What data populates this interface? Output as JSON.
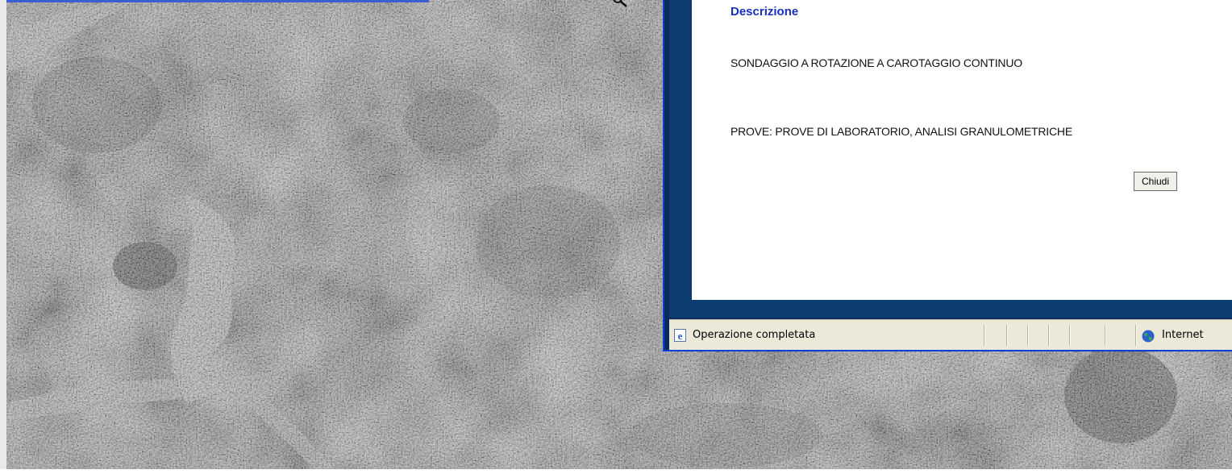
{
  "popup": {
    "heading": "Descrizione",
    "lines": [
      "SONDAGGIO A ROTAZIONE A CAROTAGGIO CONTINUO",
      "PROVE: PROVE DI LABORATORIO, ANALISI GRANULOMETRICHE"
    ],
    "close_label": "Chiudi"
  },
  "statusbar": {
    "status_text": "Operazione completata",
    "status_icon": "ie-page-icon",
    "zone_text": "Internet",
    "zone_icon": "globe-icon"
  },
  "colors": {
    "heading": "#1a2fc0",
    "window_frame": "#0d3c70",
    "statusbar_bg": "#ece9d8"
  }
}
